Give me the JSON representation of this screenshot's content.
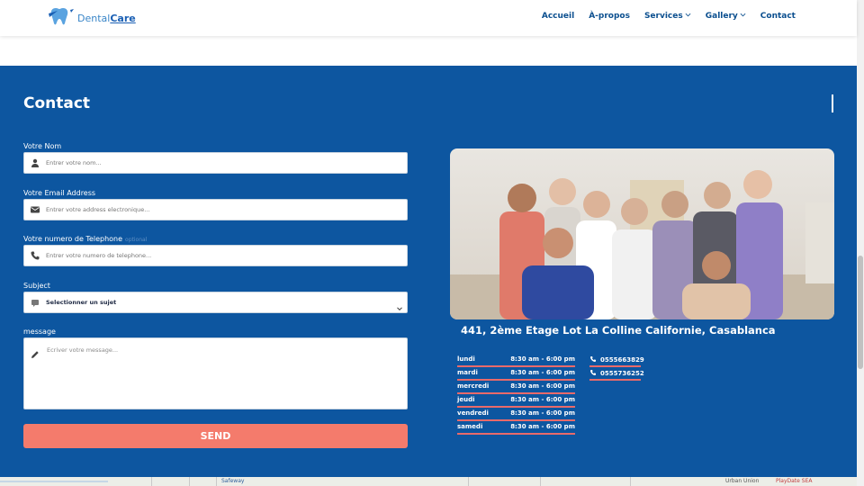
{
  "brand": {
    "name_part1": "Dental",
    "name_part2": "Care",
    "logo_icon": "tooth-icon"
  },
  "nav": {
    "items": [
      {
        "label": "Accueil",
        "has_dropdown": false
      },
      {
        "label": "À-propos",
        "has_dropdown": false
      },
      {
        "label": "Services",
        "has_dropdown": true
      },
      {
        "label": "Gallery",
        "has_dropdown": true
      },
      {
        "label": "Contact",
        "has_dropdown": false
      }
    ]
  },
  "contact": {
    "title": "Contact",
    "form": {
      "name_label": "Votre Nom",
      "name_placeholder": "Entrer votre nom...",
      "email_label": "Votre Email Address",
      "email_placeholder": "Entrer votre address electronique...",
      "phone_label": "Votre numero de Telephone",
      "phone_optional": "optional",
      "phone_placeholder": "Entrer votre numero de telephone...",
      "subject_label": "Subject",
      "subject_selected": "Selectionner un sujet",
      "message_label": "message",
      "message_placeholder": "Ecriver votre message...",
      "send_label": "SEND"
    },
    "address": "441, 2ème Etage Lot La Colline Californie, Casablanca",
    "hours": [
      {
        "day": "lundi",
        "time": "8:30 am - 6:00 pm"
      },
      {
        "day": "mardi",
        "time": "8:30 am - 6:00 pm"
      },
      {
        "day": "mercredi",
        "time": "8:30 am - 6:00 pm"
      },
      {
        "day": "jeudi",
        "time": "8:30 am - 6:00 pm"
      },
      {
        "day": "vendredi",
        "time": "8:30 am - 6:00 pm"
      },
      {
        "day": "samedi",
        "time": "8:30 am - 6:00 pm"
      }
    ],
    "phones": [
      "0555663829",
      "0555736252"
    ]
  },
  "map": {
    "labels": [
      "Safeway",
      "Urban Union",
      "PlayDate SEA"
    ]
  },
  "colors": {
    "primary_blue": "#0d56a0",
    "nav_text": "#0b4f8f",
    "send_button": "#f47b6c",
    "underline": "#e86a6a"
  }
}
